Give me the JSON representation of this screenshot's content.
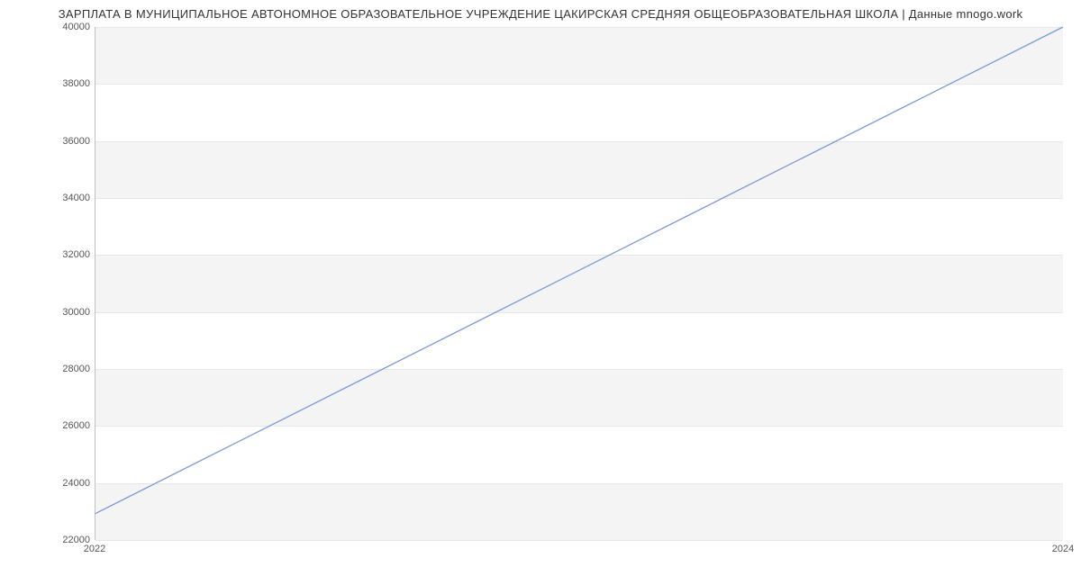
{
  "chart_data": {
    "type": "line",
    "title": "ЗАРПЛАТА В МУНИЦИПАЛЬНОЕ АВТОНОМНОЕ ОБРАЗОВАТЕЛЬНОЕ УЧРЕЖДЕНИЕ ЦАКИРСКАЯ СРЕДНЯЯ ОБЩЕОБРАЗОВАТЕЛЬНАЯ ШКОЛА | Данные mnogo.work",
    "x": [
      2022,
      2024
    ],
    "values": [
      22900,
      40000
    ],
    "xlabel": "",
    "ylabel": "",
    "x_ticks": [
      2022,
      2024
    ],
    "y_ticks": [
      22000,
      24000,
      26000,
      28000,
      30000,
      32000,
      34000,
      36000,
      38000,
      40000
    ],
    "xlim": [
      2022,
      2024
    ],
    "ylim": [
      22000,
      40000
    ],
    "bands": [
      [
        22000,
        24000
      ],
      [
        26000,
        28000
      ],
      [
        30000,
        32000
      ],
      [
        34000,
        36000
      ],
      [
        38000,
        40000
      ]
    ],
    "line_color": "#7a99d8"
  }
}
